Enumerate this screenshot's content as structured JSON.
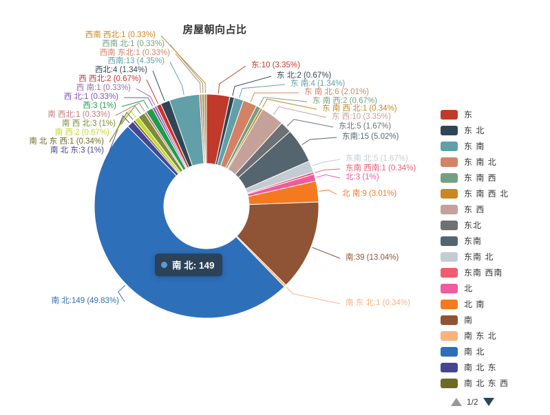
{
  "title": "房屋朝向占比",
  "tooltip": {
    "name": "南北",
    "value": "149",
    "text": "南 北: 149",
    "color": "#5b9bd5"
  },
  "legend": {
    "page": "1/2",
    "items": [
      {
        "label": "东",
        "color": "#c0392b"
      },
      {
        "label": "东 北",
        "color": "#2f4554"
      },
      {
        "label": "东 南",
        "color": "#61a0a8"
      },
      {
        "label": "东 南 北",
        "color": "#d48265"
      },
      {
        "label": "东 南 西",
        "color": "#749f83"
      },
      {
        "label": "东 南 西 北",
        "color": "#ca8622"
      },
      {
        "label": "东 西",
        "color": "#c4a29a"
      },
      {
        "label": "东北",
        "color": "#6e7074"
      },
      {
        "label": "东南",
        "color": "#546570"
      },
      {
        "label": "东南 北",
        "color": "#c4ccd3"
      },
      {
        "label": "东南 西南",
        "color": "#f05b72"
      },
      {
        "label": "北",
        "color": "#ef5b9c"
      },
      {
        "label": "北 南",
        "color": "#f47920"
      },
      {
        "label": "南",
        "color": "#8e5435"
      },
      {
        "label": "南 东 北",
        "color": "#fab27b"
      },
      {
        "label": "南 北",
        "color": "#2e6fba"
      },
      {
        "label": "南 北 东",
        "color": "#444693"
      },
      {
        "label": "南 北 东 西",
        "color": "#6d6a26"
      }
    ]
  },
  "chart_data": {
    "type": "pie",
    "title": "房屋朝向占比",
    "total": 299,
    "donut": true,
    "legend_position": "right",
    "categories": [
      "东",
      "东 北",
      "东 南",
      "东 南 北",
      "东 南 西",
      "东 南 西 北",
      "东 西",
      "东北",
      "东南",
      "东南 北",
      "东南 西南",
      "北",
      "北 南",
      "南",
      "南 东 北",
      "南 北",
      "南 北 东",
      "南 北 东 西",
      "南 西",
      "南 西 北",
      "南 西北",
      "西",
      "西 北",
      "西 南",
      "西 西北",
      "西北",
      "西南",
      "西南 东北",
      "西南 北",
      "西南 西北"
    ],
    "values": [
      10,
      2,
      4,
      6,
      2,
      1,
      10,
      5,
      15,
      5,
      1,
      3,
      9,
      39,
      1,
      149,
      3,
      1,
      2,
      3,
      1,
      3,
      1,
      1,
      2,
      4,
      13,
      1,
      1,
      1
    ],
    "labels": [
      {
        "name": "东",
        "value": 10,
        "pct": "3.35%",
        "text": "东:10 (3.35%)",
        "color": "#c0392b"
      },
      {
        "name": "东 北",
        "value": 2,
        "pct": "0.67%",
        "text": "东 北:2 (0.67%)",
        "color": "#2f4554"
      },
      {
        "name": "东 南",
        "value": 4,
        "pct": "1.34%",
        "text": "东 南:4 (1.34%)",
        "color": "#61a0a8"
      },
      {
        "name": "东 南 北",
        "value": 6,
        "pct": "2.01%",
        "text": "东 南 北:6 (2.01%)",
        "color": "#d48265"
      },
      {
        "name": "东 南 西",
        "value": 2,
        "pct": "0.67%",
        "text": "东 南 西:2 (0.67%)",
        "color": "#749f83"
      },
      {
        "name": "东 南 西 北",
        "value": 1,
        "pct": "0.34%",
        "text": "东 南 西 北:1 (0.34%)",
        "color": "#ca8622"
      },
      {
        "name": "东 西",
        "value": 10,
        "pct": "3.35%",
        "text": "东 西:10 (3.35%)",
        "color": "#c4a29a"
      },
      {
        "name": "东北",
        "value": 5,
        "pct": "1.67%",
        "text": "东北:5 (1.67%)",
        "color": "#6e7074"
      },
      {
        "name": "东南",
        "value": 15,
        "pct": "5.02%",
        "text": "东南:15 (5.02%)",
        "color": "#546570"
      },
      {
        "name": "东南 北",
        "value": 5,
        "pct": "1.67%",
        "text": "东南 北:5 (1.67%)",
        "color": "#c4ccd3"
      },
      {
        "name": "东南 西南",
        "value": 1,
        "pct": "0.34%",
        "text": "东南 西南:1 (0.34%)",
        "color": "#f05b72"
      },
      {
        "name": "北",
        "value": 3,
        "pct": "1%",
        "text": "北:3 (1%)",
        "color": "#ef5b9c"
      },
      {
        "name": "北 南",
        "value": 9,
        "pct": "3.01%",
        "text": "北 南:9 (3.01%)",
        "color": "#f47920"
      },
      {
        "name": "南",
        "value": 39,
        "pct": "13.04%",
        "text": "南:39 (13.04%)",
        "color": "#8e5435"
      },
      {
        "name": "南 东 北",
        "value": 1,
        "pct": "0.34%",
        "text": "南 东 北:1 (0.34%)",
        "color": "#fab27b"
      },
      {
        "name": "南 北",
        "value": 149,
        "pct": "49.83%",
        "text": "南 北:149 (49.83%)",
        "color": "#2e6fba"
      },
      {
        "name": "南 北 东",
        "value": 3,
        "pct": "1%",
        "text": "南 北 东:3 (1%)",
        "color": "#444693"
      },
      {
        "name": "南 北 东 西",
        "value": 1,
        "pct": "0.34%",
        "text": "南 北 东 西:1 (0.34%)",
        "color": "#6d6a26"
      },
      {
        "name": "南 西",
        "value": 2,
        "pct": "0.67%",
        "text": "南 西:2 (0.67%)",
        "color": "#c5d82e"
      },
      {
        "name": "南 西 北",
        "value": 3,
        "pct": "1%",
        "text": "南 西 北:3 (1%)",
        "color": "#7d8b3a"
      },
      {
        "name": "南 西北",
        "value": 1,
        "pct": "0.33%",
        "text": "南 西北:1 (0.33%)",
        "color": "#c47a7a"
      },
      {
        "name": "西",
        "value": 3,
        "pct": "1%",
        "text": "西:3 (1%)",
        "color": "#1e9c4c"
      },
      {
        "name": "西 北",
        "value": 1,
        "pct": "0.33%",
        "text": "西 北:1 (0.33%)",
        "color": "#8053b5"
      },
      {
        "name": "西 南",
        "value": 1,
        "pct": "0.33%",
        "text": "西 南:1 (0.33%)",
        "color": "#9a6fa0"
      },
      {
        "name": "西 西北",
        "value": 2,
        "pct": "0.67%",
        "text": "西 西北:2 (0.67%)",
        "color": "#d0312d"
      },
      {
        "name": "西北",
        "value": 4,
        "pct": "1.34%",
        "text": "西北:4 (1.34%)",
        "color": "#2f4554"
      },
      {
        "name": "西南",
        "value": 13,
        "pct": "4.35%",
        "text": "西南:13 (4.35%)",
        "color": "#61a0a8"
      },
      {
        "name": "西南 东北",
        "value": 1,
        "pct": "0.33%",
        "text": "西南 东北:1 (0.33%)",
        "color": "#d48265"
      },
      {
        "name": "西南 北",
        "value": 1,
        "pct": "0.33%",
        "text": "西南 北:1 (0.33%)",
        "color": "#749f83"
      },
      {
        "name": "西南 西北",
        "value": 1,
        "pct": "0.33%",
        "text": "西南 西北:1 (0.33%)",
        "color": "#ca8622"
      }
    ]
  }
}
